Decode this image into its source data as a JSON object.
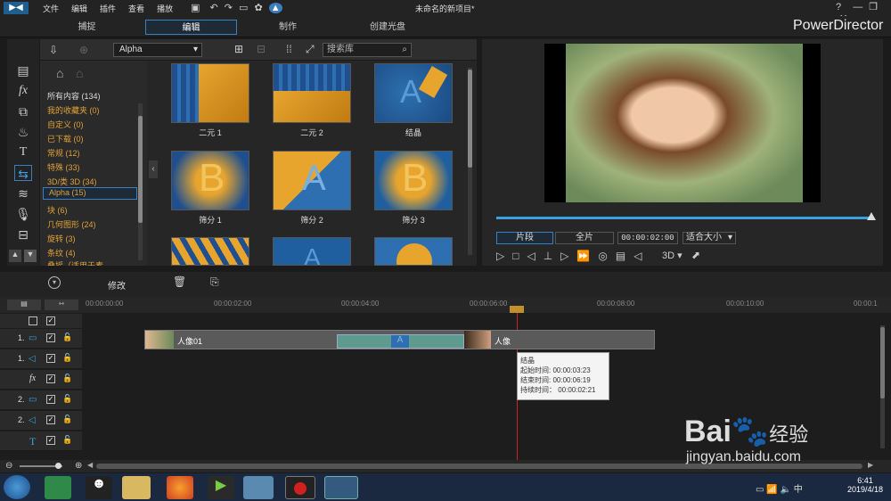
{
  "menu": [
    "文件",
    "编辑",
    "插件",
    "查看",
    "播放"
  ],
  "project_title": "未命名的新项目*",
  "app_name": "PowerDirector",
  "modes": [
    "捕捉",
    "编辑",
    "制作",
    "创建光盘"
  ],
  "library": {
    "filter": "Alpha",
    "search_placeholder": "搜索库"
  },
  "categories": [
    "所有内容 (134)",
    "我的收藏夹 (0)",
    "自定义 (0)",
    "已下载 (0)",
    "常规 (12)",
    "特殊 (33)",
    "3D/类 3D (34)",
    "Alpha (15)",
    "块 (6)",
    "几何图形 (24)",
    "旋转 (3)",
    "条纹 (4)",
    "叠摇（适用于素"
  ],
  "transitions": [
    {
      "label": "二元 1",
      "icon": "binary-icon"
    },
    {
      "label": "二元 2",
      "icon": "binary-icon"
    },
    {
      "label": "结晶",
      "icon": "crystal-icon"
    },
    {
      "label": "筛分 1",
      "icon": "sieve-icon"
    },
    {
      "label": "筛分 2",
      "icon": "sieve-icon"
    },
    {
      "label": "筛分 3",
      "icon": "sieve-icon"
    }
  ],
  "player": {
    "clip_tab": "片段",
    "movie_tab": "全片",
    "timecode": "00:00:02:00",
    "fit": "适合大小",
    "threed": "3D"
  },
  "toolbar": {
    "modify": "修改"
  },
  "ruler": [
    "00:00:00:00",
    "00:00:02:00",
    "00:00:04:00",
    "00:00:06:00",
    "00:00:08:00",
    "00:00:10:00",
    "00:00:1"
  ],
  "tracks": [
    "1.",
    "1.",
    "fx",
    "2.",
    "2.",
    "T"
  ],
  "clip": {
    "label": "人像01",
    "label2": "人像"
  },
  "tooltip": {
    "name": "结晶",
    "start": "起始时间: 00:00:03:23",
    "end": "结束时间: 00:00:06:19",
    "duration": "持续时间： 00:00:02:21"
  },
  "clock": {
    "time": "6:41",
    "date": "2019/4/18"
  },
  "watermark": {
    "brand": "Bai",
    "paw": "经验",
    "url": "jingyan.baidu.com"
  },
  "colors": {
    "accent": "#3a7fc0",
    "category": "#e0a23a"
  }
}
